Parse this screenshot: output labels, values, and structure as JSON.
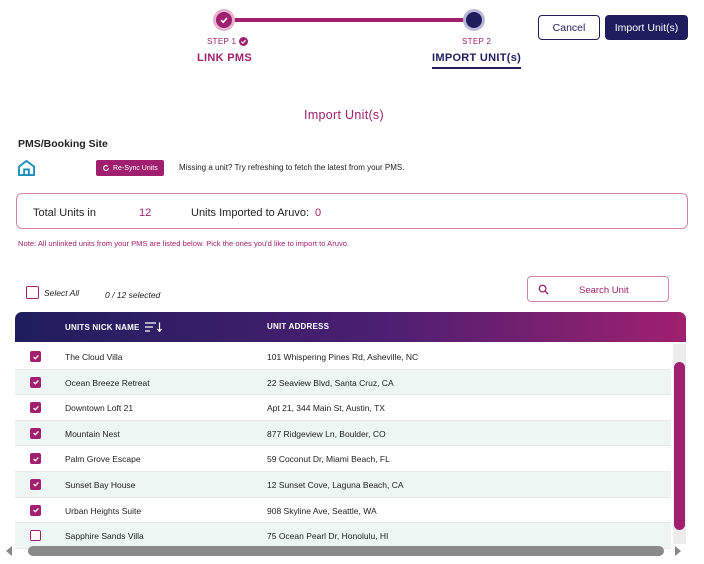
{
  "stepper": {
    "step1": {
      "caption": "STEP 1",
      "title": "LINK PMS"
    },
    "step2": {
      "caption": "STEP 2",
      "title": "IMPORT UNIT(s)"
    }
  },
  "actions": {
    "cancel_label": "Cancel",
    "import_label": "Import Unit(s)"
  },
  "page_title": "Import Unit(s)",
  "pms": {
    "label": "PMS/Booking Site",
    "resync_label": "Re-Sync Units",
    "hint": "Missing a unit? Try refreshing to fetch the latest from your PMS."
  },
  "summary": {
    "total_label": "Total Units in",
    "total_value": "12",
    "imported_label": "Units Imported to Aruvo:",
    "imported_value": "0"
  },
  "note": "Note: All unlinked units from your PMS are listed below. Pick the ones you'd like to import to Aruvo.",
  "selection": {
    "select_all_label": "Select All",
    "count": "0 / 12 selected"
  },
  "search": {
    "placeholder": "Search Unit"
  },
  "table": {
    "columns": {
      "name": "UNITS NICK NAME",
      "address": "UNIT ADDRESS"
    },
    "rows": [
      {
        "name": "The Cloud Villa",
        "address": "101 Whispering Pines Rd, Asheville, NC",
        "checked": true
      },
      {
        "name": "Ocean Breeze Retreat",
        "address": "22 Seaview Blvd, Santa Cruz, CA",
        "checked": true
      },
      {
        "name": "Downtown Loft 21",
        "address": "Apt 21, 344 Main St, Austin, TX",
        "checked": true
      },
      {
        "name": "Mountain Nest",
        "address": "877 Ridgeview Ln, Boulder, CO",
        "checked": true
      },
      {
        "name": "Palm Grove Escape",
        "address": "59 Coconut Dr, Miami Beach, FL",
        "checked": true
      },
      {
        "name": "Sunset Bay House",
        "address": "12 Sunset Cove, Laguna Beach, CA",
        "checked": true
      },
      {
        "name": "Urban Heights Suite",
        "address": "908 Skyline Ave, Seattle, WA",
        "checked": true
      },
      {
        "name": "Sapphire Sands Villa",
        "address": "75 Ocean Pearl Dr, Honolulu, HI",
        "checked": false
      }
    ]
  },
  "colors": {
    "brand_magenta": "#a0206f",
    "brand_navy": "#1f1d5e",
    "row_alt": "#edf6f3"
  },
  "icons": {
    "step_done": "check-icon",
    "pms_logo": "home-icon",
    "resync": "refresh-icon",
    "search": "search-icon",
    "sort": "sort-icon"
  }
}
